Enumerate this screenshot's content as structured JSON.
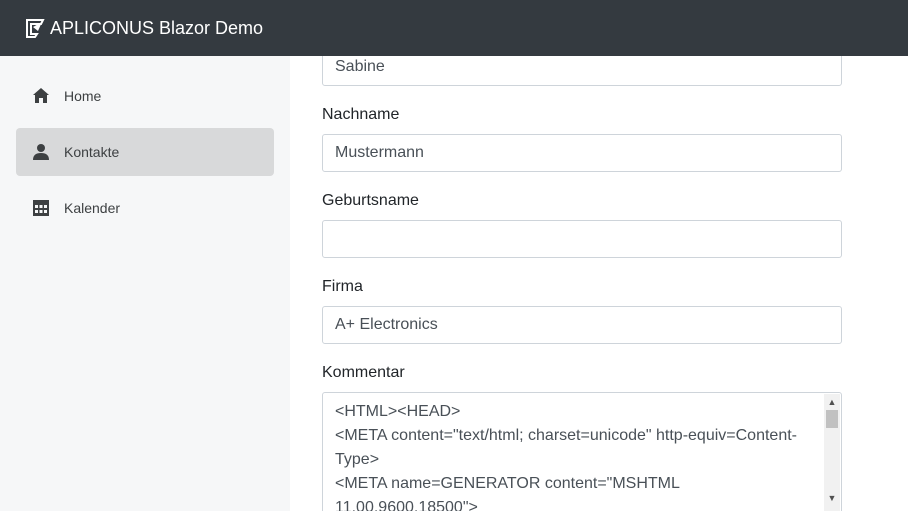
{
  "app": {
    "brand": "APLICONUS Blazor Demo"
  },
  "sidebar": {
    "items": [
      {
        "label": "Home",
        "icon": "home-icon",
        "active": false
      },
      {
        "label": "Kontakte",
        "icon": "person-icon",
        "active": true
      },
      {
        "label": "Kalender",
        "icon": "calendar-icon",
        "active": false
      }
    ]
  },
  "form": {
    "vorname_value": "Sabine",
    "nachname_label": "Nachname",
    "nachname_value": "Mustermann",
    "geburtsname_label": "Geburtsname",
    "geburtsname_value": "",
    "firma_label": "Firma",
    "firma_value": "A+ Electronics",
    "kommentar_label": "Kommentar",
    "kommentar_value": "<HTML><HEAD>\n<META content=\"text/html; charset=unicode\" http-equiv=Content-\nType>\n<META name=GENERATOR content=\"MSHTML\n11.00.9600.18500\">"
  },
  "colors": {
    "topbar": "#343a40",
    "sidebar": "#f6f7f8",
    "active_item": "#d8d9da"
  }
}
